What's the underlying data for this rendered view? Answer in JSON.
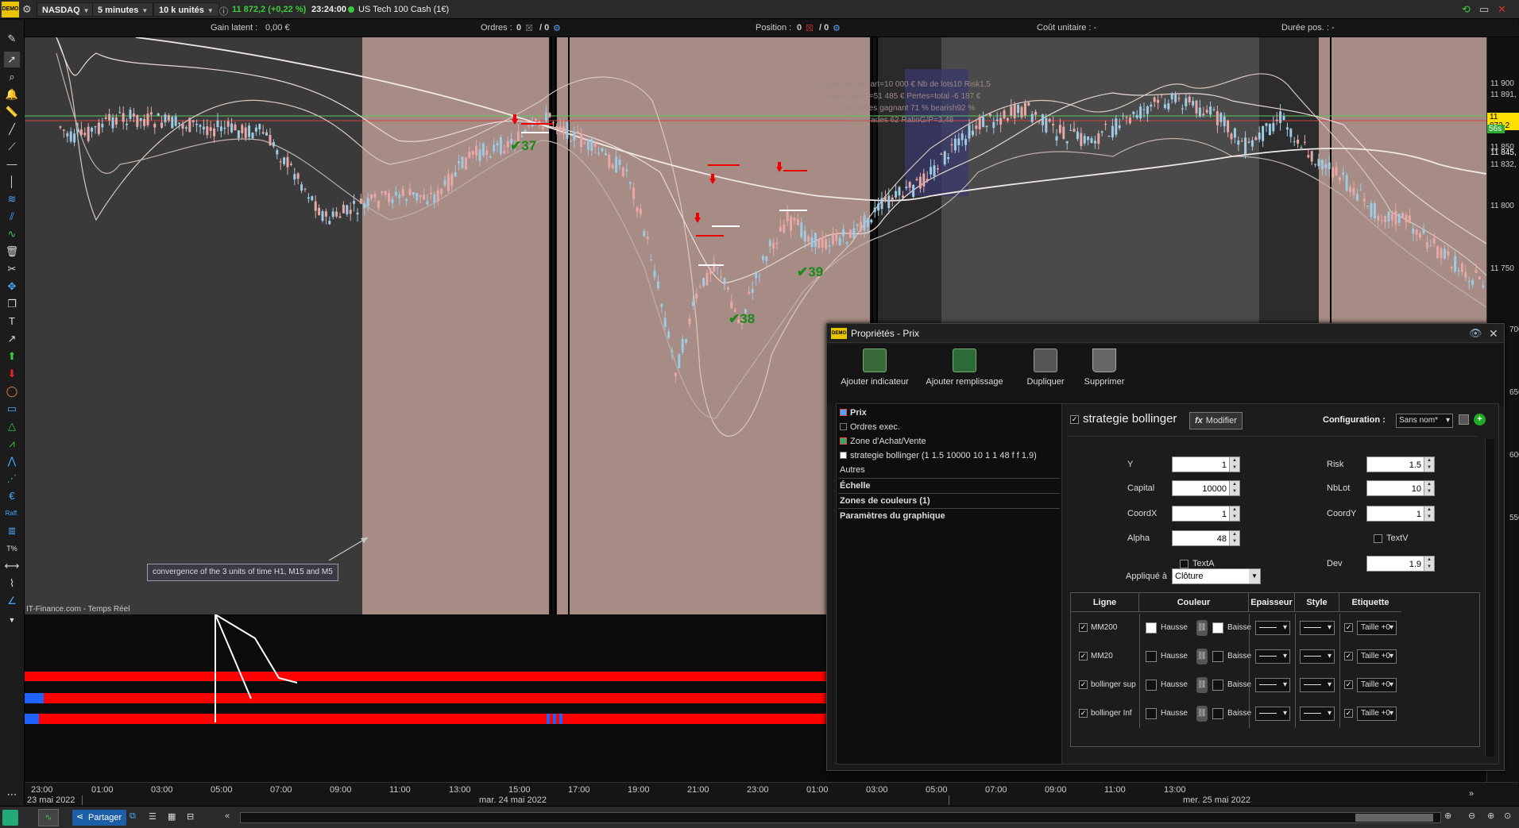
{
  "topbar": {
    "logo": "DEMO",
    "symbol": "NASDAQ",
    "timeframe": "5 minutes",
    "units": "10 k unités",
    "quote": "11 872,2 (+0,22 %)",
    "time": "23:24:00",
    "instrument": "US Tech 100 Cash (1€)"
  },
  "infobar": {
    "gain_label": "Gain latent :",
    "gain_value": "0,00 €",
    "orders_label": "Ordres :",
    "orders_a": "0",
    "orders_b": "/ 0",
    "position_label": "Position :",
    "position_a": "0",
    "position_b": "/ 0",
    "cost_label": "Coût unitaire : -",
    "duration_label": "Durée pos. : -"
  },
  "chart": {
    "overlay_stats": [
      "Capital de départ=10 000 € Nb de lots10  Risk1,5",
      "Gains gains=51 485 € Pertes=total -6 187 €",
      "% de trades gagnant 71 % bearish92 %",
      "Total trades 62  RatioG/P=3,48"
    ],
    "trade_labels": [
      "37",
      "38",
      "39"
    ],
    "annotation": "convergence of the 3 units of time H1, M15 and M5",
    "source": "IT-Finance.com - Temps Réel"
  },
  "price_axis": {
    "labels": [
      "11 900",
      "11 891,",
      "11 872,2",
      "56s",
      "11 850",
      "11 845,",
      "11 832,",
      "11 800",
      "11 750",
      "700",
      "650",
      "600",
      "550"
    ],
    "highlight_color": "#ffe000"
  },
  "time_axis": {
    "labels": [
      "23:00",
      "01:00",
      "03:00",
      "05:00",
      "07:00",
      "09:00",
      "11:00",
      "13:00",
      "15:00",
      "17:00",
      "19:00",
      "21:00",
      "23:00",
      "01:00",
      "03:00",
      "05:00",
      "07:00",
      "09:00",
      "11:00",
      "13:00"
    ],
    "dates": [
      "23 mai 2022",
      "mar. 24 mai 2022",
      "mer. 25 mai 2022"
    ]
  },
  "bottombar": {
    "share_label": "Partager"
  },
  "dialog": {
    "title": "Propriétés - Prix",
    "toolbar": {
      "add_indicator": "Ajouter indicateur",
      "add_fill": "Ajouter remplissage",
      "duplicate": "Dupliquer",
      "delete": "Supprimer"
    },
    "tree": {
      "items": [
        "Prix",
        "Ordres exec.",
        "Zone d'Achat/Vente",
        "strategie bollinger (1 1.5 10000 10 1 1 48 f f 1.9)",
        "Autres"
      ],
      "sections": [
        "Échelle",
        "Zones de couleurs (1)",
        "Paramètres du graphique"
      ]
    },
    "indicator": {
      "name": "strategie bollinger",
      "modify_label": "Modifier",
      "config_label": "Configuration :",
      "config_value": "Sans nom*"
    },
    "params": {
      "y_label": "Y",
      "y_value": "1",
      "capital_label": "Capital",
      "capital_value": "10000",
      "coordx_label": "CoordX",
      "coordx_value": "1",
      "alpha_label": "Alpha",
      "alpha_value": "48",
      "texta_label": "TextA",
      "risk_label": "Risk",
      "risk_value": "1.5",
      "nblot_label": "NbLot",
      "nblot_value": "10",
      "coordy_label": "CoordY",
      "coordy_value": "1",
      "textv_label": "TextV",
      "dev_label": "Dev",
      "dev_value": "1.9",
      "applied_label": "Appliqué à",
      "applied_value": "Clôture"
    },
    "table": {
      "headers": [
        "Ligne",
        "Couleur",
        "Epaisseur",
        "Style",
        "Etiquette"
      ],
      "rows": [
        {
          "name": "MM200",
          "up": "Hausse",
          "down": "Baisse",
          "label": "Taille +0"
        },
        {
          "name": "MM20",
          "up": "Hausse",
          "down": "Baisse",
          "label": "Taille +0"
        },
        {
          "name": "bollinger sup",
          "up": "Hausse",
          "down": "Baisse",
          "label": "Taille +0"
        },
        {
          "name": "bollinger Inf",
          "up": "Hausse",
          "down": "Baisse",
          "label": "Taille +0"
        }
      ]
    }
  }
}
